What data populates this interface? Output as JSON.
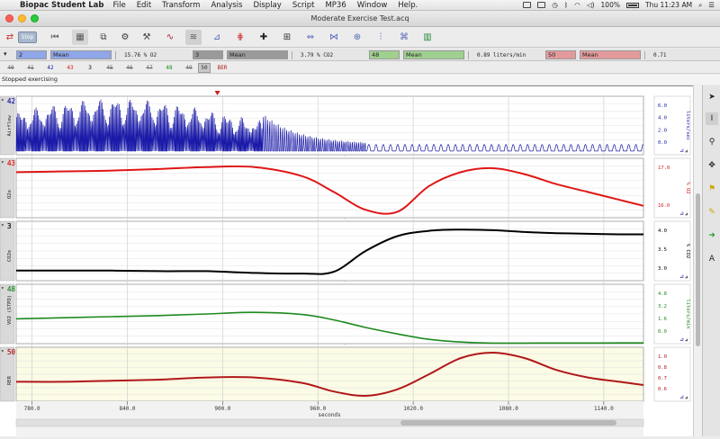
{
  "menubar": {
    "app": "Biopac Student Lab",
    "items": [
      "File",
      "Edit",
      "Transform",
      "Analysis",
      "Display",
      "Script",
      "MP36",
      "Window",
      "Help."
    ],
    "battery": "100%",
    "clock": "Thu 11:23 AM"
  },
  "window": {
    "title": "Moderate Exercise Test.acq"
  },
  "toolbar": {
    "stop_label": "Stop"
  },
  "measurements": [
    {
      "channel": "2",
      "func": "Mean",
      "value": "15.76 % O2",
      "color": "#8fa6e8"
    },
    {
      "channel": "3",
      "func": "Mean",
      "value": "3.79 % CO2",
      "color": "#9a9a9a"
    },
    {
      "channel": "48",
      "func": "Mean",
      "value": "0.89 liters/min",
      "color": "#9fd08f"
    },
    {
      "channel": "50",
      "func": "Mean",
      "value": "0.71",
      "color": "#e39a9a"
    }
  ],
  "channel_toggles": [
    "40",
    "41",
    "42",
    "43",
    "3",
    "45",
    "46",
    "47",
    "48",
    "49",
    "50",
    "BER"
  ],
  "status": "Stopped exercising",
  "channels": [
    {
      "id": "42",
      "label": "Airflow",
      "unit": "liters/sec",
      "ticks": [
        "6.0",
        "4.0",
        "2.0",
        "0.0"
      ],
      "color": "#1a1aa8"
    },
    {
      "id": "43",
      "label": "O2e",
      "unit": "% O2",
      "ticks": [
        "17.0",
        "16.0"
      ],
      "color": "#e01616"
    },
    {
      "id": "3",
      "label": "CO2e",
      "unit": "% CO2",
      "ticks": [
        "4.0",
        "3.5",
        "3.0"
      ],
      "color": "#000000"
    },
    {
      "id": "48",
      "label": "VO2 (STPD)",
      "unit": "liters/min",
      "ticks": [
        "4.8",
        "3.2",
        "1.6",
        "0.0"
      ],
      "color": "#1f8a1f"
    },
    {
      "id": "50",
      "label": "RER",
      "unit": "",
      "ticks": [
        "1.0",
        "0.8",
        "0.7",
        "0.6"
      ],
      "color": "#b01818"
    }
  ],
  "time_axis": {
    "ticks": [
      "780.0",
      "840.0",
      "900.0",
      "960.0",
      "1020.0",
      "1080.0",
      "1140.0"
    ],
    "label": "seconds",
    "range": [
      770,
      1165
    ]
  },
  "chart_data": {
    "type": "line",
    "xlabel": "seconds",
    "x": [
      770,
      800,
      830,
      860,
      890,
      920,
      950,
      970,
      990,
      1010,
      1030,
      1050,
      1070,
      1090,
      1110,
      1130,
      1150,
      1165
    ],
    "series": [
      {
        "name": "O2e",
        "values": [
          16.95,
          16.97,
          16.99,
          17.03,
          17.08,
          17.08,
          16.85,
          16.45,
          16.0,
          15.95,
          16.6,
          16.95,
          17.05,
          16.9,
          16.65,
          16.45,
          16.25,
          16.1
        ]
      },
      {
        "name": "CO2e",
        "values": [
          3.17,
          3.17,
          3.17,
          3.16,
          3.16,
          3.13,
          3.12,
          3.15,
          3.5,
          3.75,
          3.84,
          3.86,
          3.85,
          3.82,
          3.8,
          3.79,
          3.78,
          3.78
        ]
      },
      {
        "name": "VO2 (STPD)",
        "values": [
          2.3,
          2.4,
          2.5,
          2.6,
          2.75,
          2.9,
          2.7,
          2.2,
          1.5,
          0.9,
          0.4,
          0.15,
          0.05,
          0.05,
          0.06,
          0.06,
          0.07,
          0.07
        ]
      },
      {
        "name": "RER",
        "values": [
          0.73,
          0.73,
          0.74,
          0.75,
          0.77,
          0.77,
          0.72,
          0.64,
          0.6,
          0.66,
          0.8,
          0.95,
          1.0,
          0.95,
          0.84,
          0.77,
          0.73,
          0.7
        ]
      }
    ]
  }
}
